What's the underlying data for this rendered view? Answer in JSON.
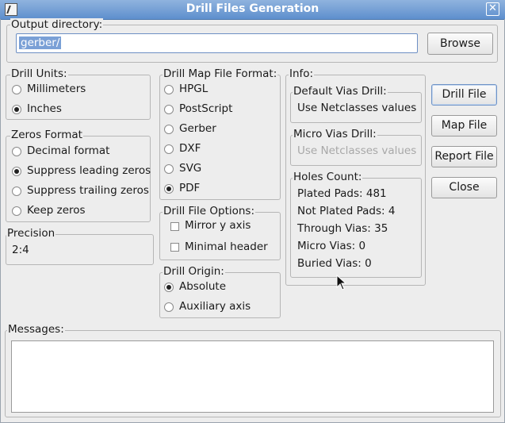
{
  "window": {
    "title": "Drill Files Generation"
  },
  "output": {
    "label": "Output directory:",
    "value": "gerber/",
    "browse": "Browse"
  },
  "drill_units": {
    "label": "Drill Units:",
    "options": [
      "Millimeters",
      "Inches"
    ],
    "selected": 1
  },
  "zeros": {
    "label": "Zeros Format",
    "options": [
      "Decimal format",
      "Suppress leading zeros",
      "Suppress trailing zeros",
      "Keep zeros"
    ],
    "selected": 1
  },
  "precision": {
    "label": "Precision",
    "value": "2:4"
  },
  "map_format": {
    "label": "Drill Map File Format:",
    "options": [
      "HPGL",
      "PostScript",
      "Gerber",
      "DXF",
      "SVG",
      "PDF"
    ],
    "selected": 5
  },
  "drill_options": {
    "label": "Drill File Options:",
    "mirror": "Mirror y axis",
    "minimal": "Minimal header"
  },
  "origin": {
    "label": "Drill Origin:",
    "options": [
      "Absolute",
      "Auxiliary axis"
    ],
    "selected": 0
  },
  "info": {
    "label": "Info:",
    "default_vias_label": "Default Vias Drill:",
    "default_vias_value": "Use Netclasses values",
    "micro_vias_label": "Micro Vias Drill:",
    "micro_vias_value": "Use Netclasses values",
    "holes_label": "Holes Count:",
    "plated": "Plated Pads: 481",
    "not_plated": "Not Plated Pads: 4",
    "through": "Through Vias: 35",
    "micro": "Micro Vias: 0",
    "buried": "Buried Vias: 0"
  },
  "buttons": {
    "drill_file": "Drill File",
    "map_file": "Map File",
    "report_file": "Report File",
    "close": "Close"
  },
  "messages": {
    "label": "Messages:"
  },
  "icons": {
    "app": "drill-app-icon",
    "close": "close-icon",
    "cursor": "mouse-cursor-icon"
  }
}
